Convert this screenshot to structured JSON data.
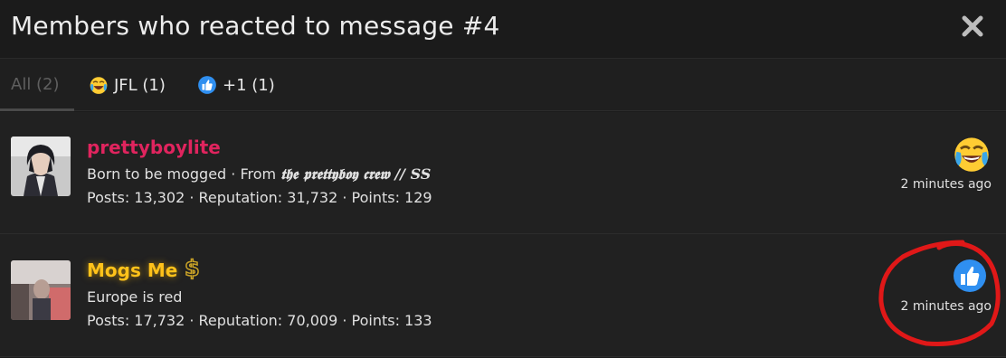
{
  "dialog": {
    "title": "Members who reacted to message #4"
  },
  "tabs": [
    {
      "label": "All (2)",
      "icon": null
    },
    {
      "label": "JFL (1)",
      "icon": "joy-emoji-icon"
    },
    {
      "label": "+1 (1)",
      "icon": "thumbs-up-icon"
    }
  ],
  "members": [
    {
      "username": "prettyboylite",
      "username_color": "#e0245e",
      "title_prefix": "Born to be mogged · From ",
      "title_styled": "𝖙𝖍𝖊 𝖕𝖗𝖊𝖙𝖙𝖞𝖇𝖔𝖞 𝖈𝖗𝖊𝖜 // SS",
      "stats": "Posts: 13,302 · Reputation: 31,732 · Points: 129",
      "reaction": "joy-emoji-icon",
      "time": "2 minutes ago"
    },
    {
      "username": "Mogs Me",
      "username_color": "#ffc21a",
      "badge": "$",
      "title_prefix": "Europe is red",
      "stats": "Posts: 17,732 · Reputation: 70,009 · Points: 133",
      "reaction": "thumbs-up-icon",
      "time": "2 minutes ago"
    }
  ]
}
